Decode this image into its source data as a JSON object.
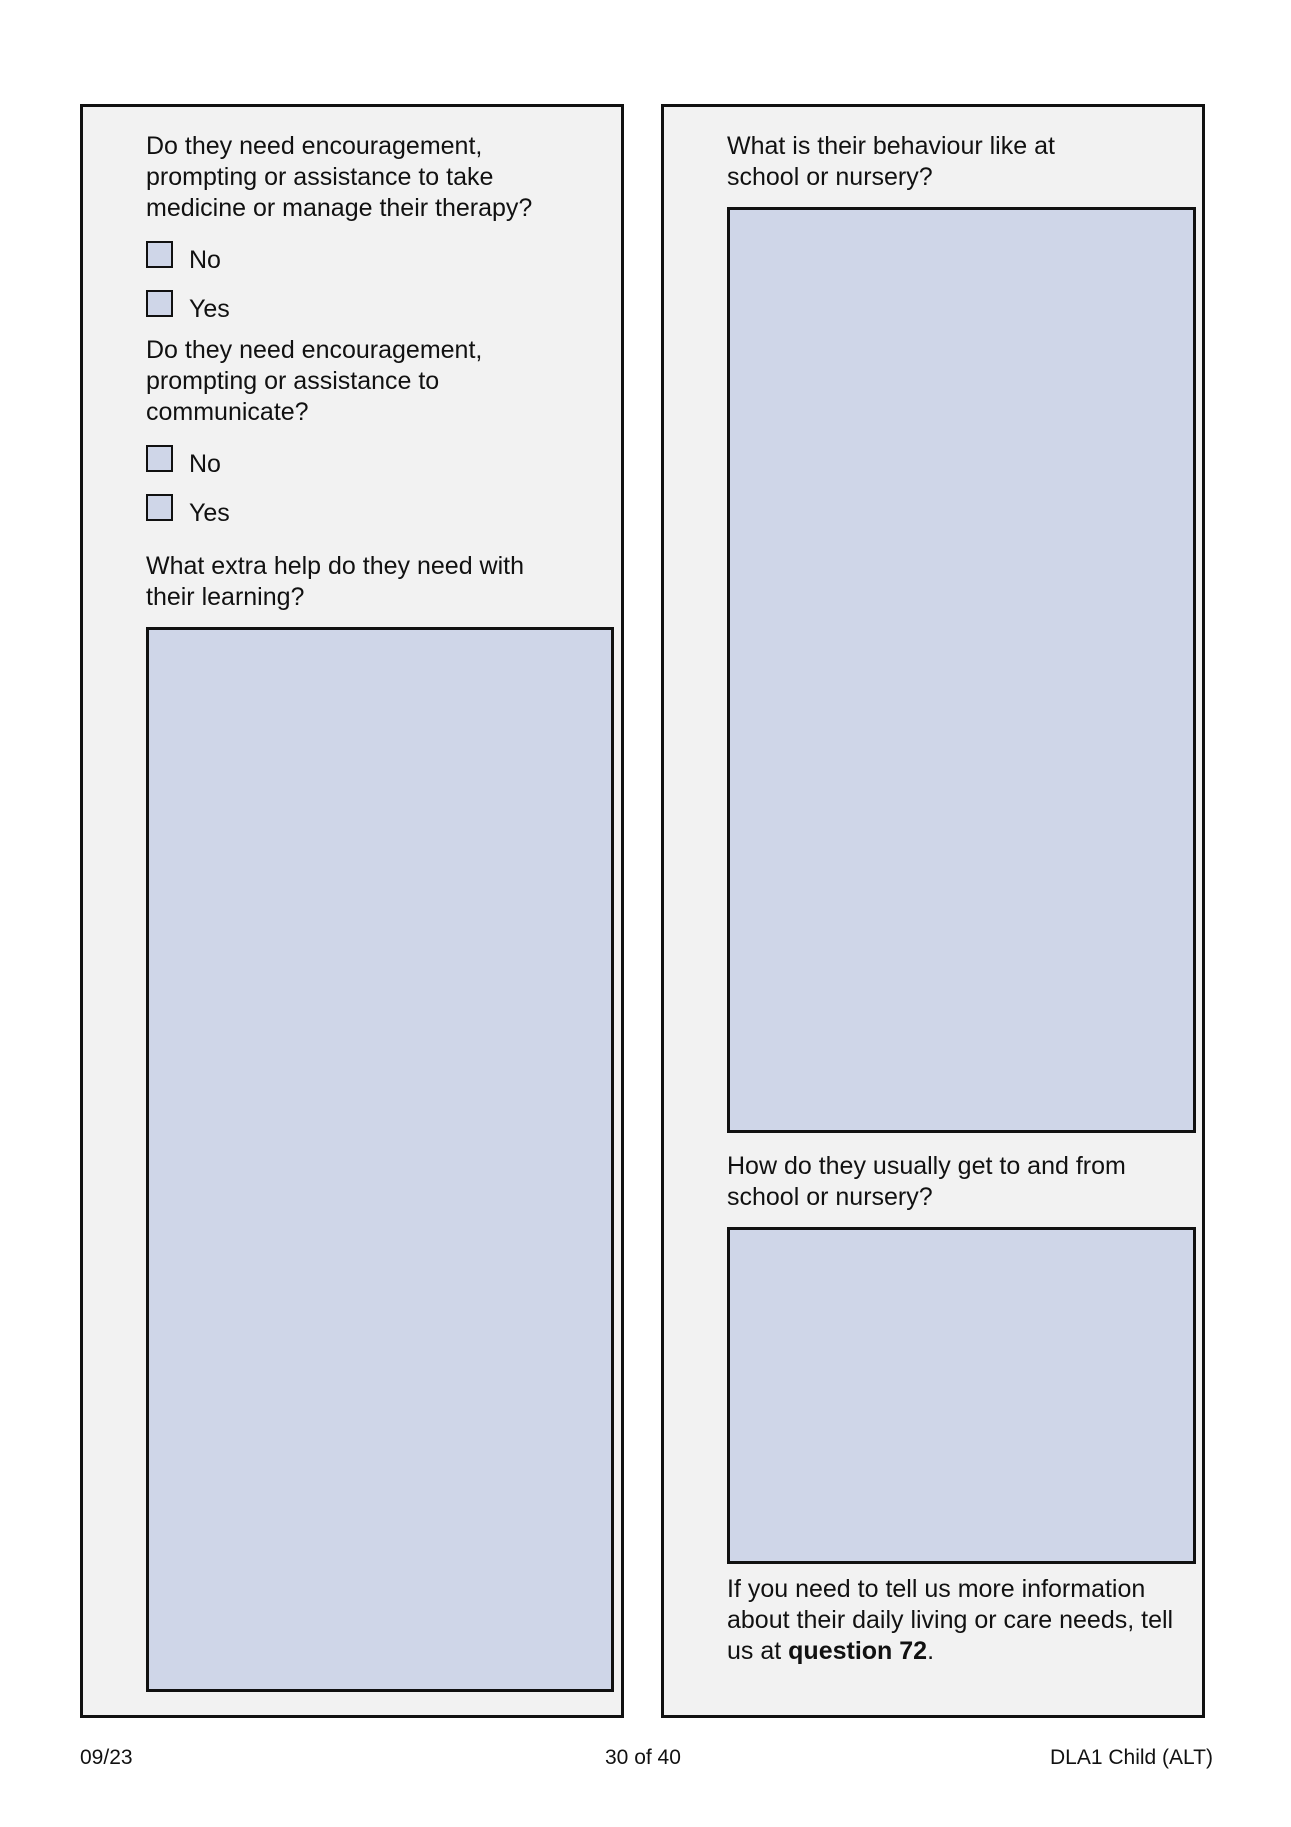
{
  "left_panel": {
    "q1": {
      "text": "Do they need encouragement, prompting or assistance to take medicine or manage their therapy?",
      "options": [
        "No",
        "Yes"
      ]
    },
    "q2": {
      "text": "Do they need encouragement, prompting or assistance to communicate?",
      "options": [
        "No",
        "Yes"
      ]
    },
    "q3": {
      "text": "What extra help do they need with their learning?"
    }
  },
  "right_panel": {
    "q4": {
      "text": "What is their behaviour like at school or nursery?"
    },
    "q5": {
      "text": "How do they usually get to and from school or nursery?"
    },
    "note": {
      "prefix": "If you need to tell us more information about their daily living or care needs, tell us at ",
      "bold": "question 72",
      "suffix": "."
    }
  },
  "footer": {
    "date": "09/23",
    "page": "30 of 40",
    "form": "DLA1 Child (ALT)"
  },
  "colors": {
    "panel_bg": "#f2f2f2",
    "field_fill": "#cfd6e8",
    "border": "#111111"
  }
}
